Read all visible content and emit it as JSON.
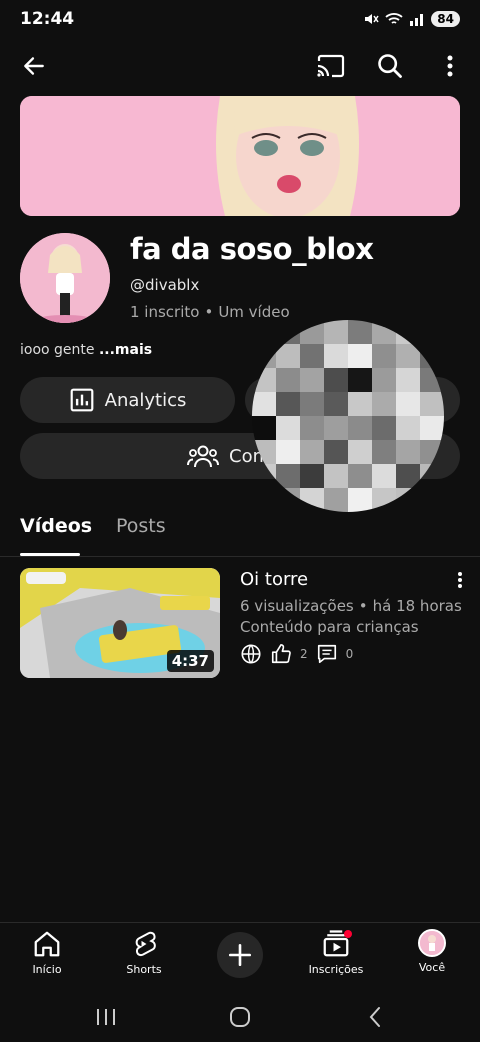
{
  "status_bar": {
    "time": "12:44",
    "battery": "84"
  },
  "top_bar": {
    "icons": [
      "back-arrow-icon",
      "cast-icon",
      "search-icon",
      "more-vert-icon"
    ]
  },
  "channel": {
    "name": "fa da soso_blox",
    "handle": "@divablx",
    "subscribers": "1 inscrito",
    "separator": "•",
    "videos_count": "Um vídeo",
    "description": "iooo gente",
    "description_more": "...mais"
  },
  "actions": {
    "analytics_label": "Analytics",
    "community_label": "Comun"
  },
  "tabs": [
    {
      "label": "Vídeos",
      "selected": true
    },
    {
      "label": "Posts",
      "selected": false
    }
  ],
  "video": {
    "title": "Oi torre",
    "views": "6 visualizações",
    "separator": "•",
    "age": "há 18 horas",
    "kids_label": "Conteúdo para crianças",
    "duration": "4:37",
    "likes": "2",
    "comments": "0"
  },
  "bottom_nav": {
    "home": "Início",
    "shorts": "Shorts",
    "subscriptions": "Inscrições",
    "you": "Você"
  },
  "colors": {
    "background": "#0f0f0f",
    "pill": "#272727",
    "banner_pink": "#f7b8d2",
    "notification_red": "#ff0033"
  }
}
